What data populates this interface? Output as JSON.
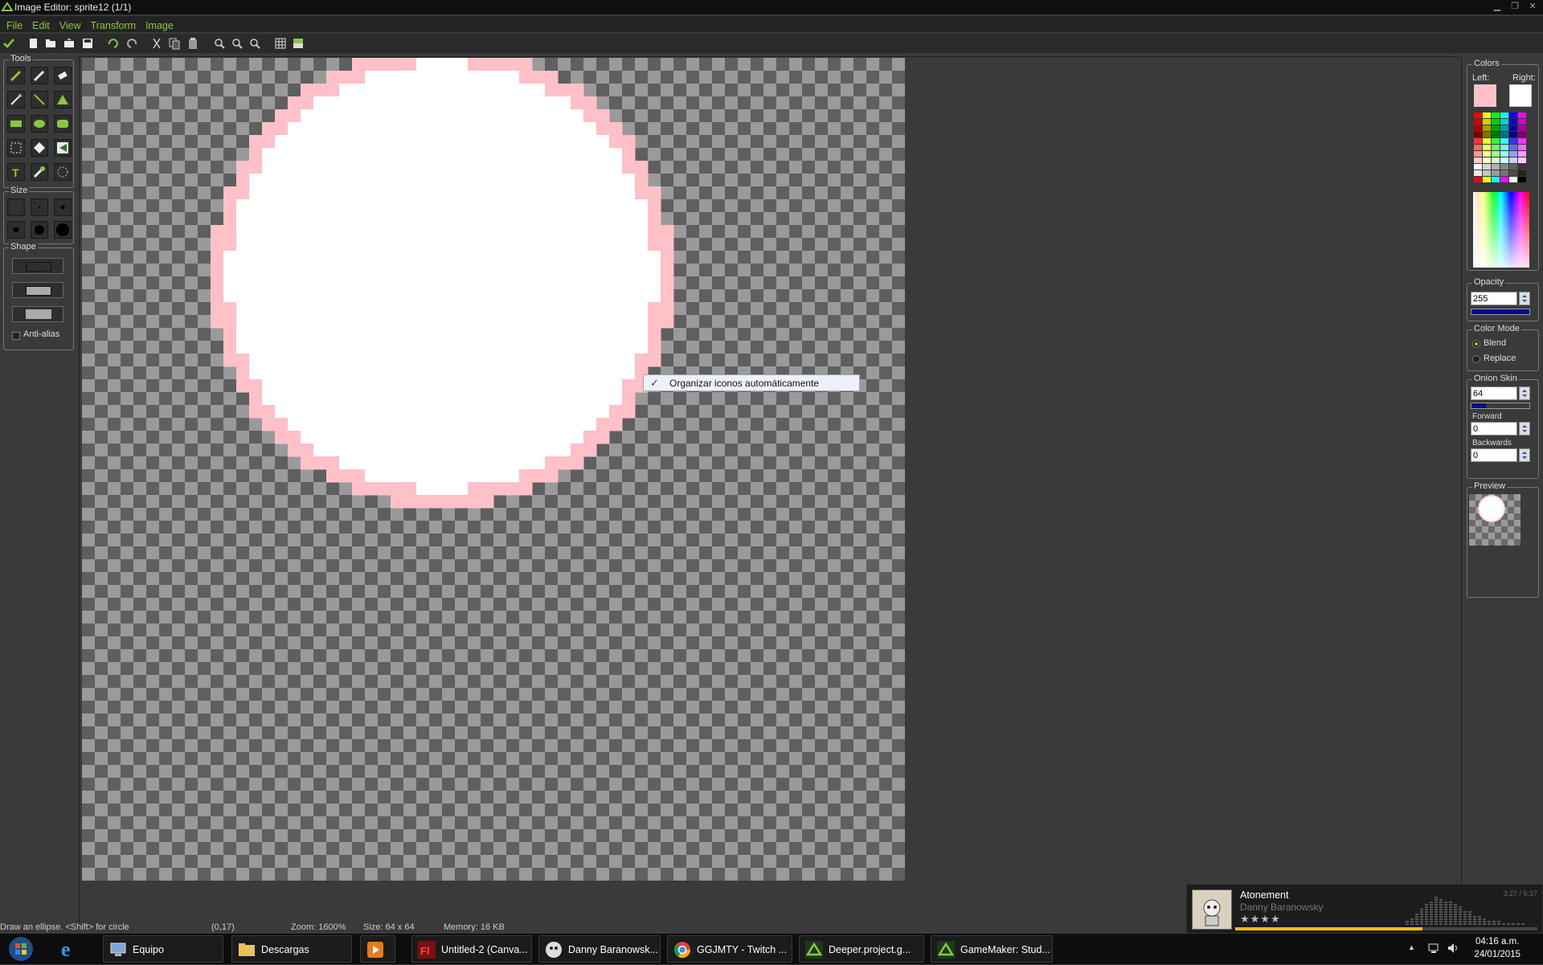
{
  "window": {
    "title": "Image Editor: sprite12 (1/1)"
  },
  "menu": [
    "File",
    "Edit",
    "View",
    "Transform",
    "Image"
  ],
  "toolbar_icons": [
    "confirm-icon",
    "new-icon",
    "open-icon",
    "import-icon",
    "save-icon",
    "undo-icon",
    "redo-icon",
    "cut-icon",
    "copy-icon",
    "paste-icon",
    "zoom-in-icon",
    "zoom-out-icon",
    "zoom-reset-icon",
    "grid-icon",
    "palette-icon"
  ],
  "panels": {
    "tools": "Tools",
    "size": "Size",
    "shape": "Shape",
    "anti_alias": "Anti-alias",
    "colors": "Colors",
    "left": "Left:",
    "right": "Right:",
    "opacity": "Opacity",
    "opacity_value": "255",
    "color_mode": "Color Mode",
    "blend": "Blend",
    "replace": "Replace",
    "onion_skin": "Onion Skin",
    "onion_value": "64",
    "forward": "Forward",
    "forward_value": "0",
    "backwards": "Backwards",
    "backwards_value": "0",
    "preview": "Preview"
  },
  "colors": {
    "left": "#ffc0c8",
    "right": "#ffffff",
    "accent": "#8dc63f"
  },
  "levels": {
    "opacity_fraction": 1.0,
    "onion_fraction": 0.25
  },
  "context_menu": {
    "item": "Organizar iconos automáticamente",
    "checked": true
  },
  "status": {
    "hint": "Draw an ellipse. <Shift> for circle",
    "coords": "(0,17)",
    "zoom": "Zoom: 1600%",
    "size": "Size: 64 x 64",
    "memory": "Memory: 16 KB"
  },
  "media": {
    "title": "Atonement",
    "artist": "Danny Baranowsky",
    "time": "3:27 / 5:37",
    "rating": 4,
    "stars": "★★★★",
    "progress": 0.62
  },
  "taskbar": {
    "items": [
      "Equipo",
      "Descargas",
      "",
      "Untitled-2 (Canva...",
      "Danny Baranowsk...",
      "GGJMTY - Twitch ...",
      "Deeper.project.g...",
      "GameMaker: Stud..."
    ],
    "time": "04:16 a.m.",
    "date": "24/01/2015"
  }
}
